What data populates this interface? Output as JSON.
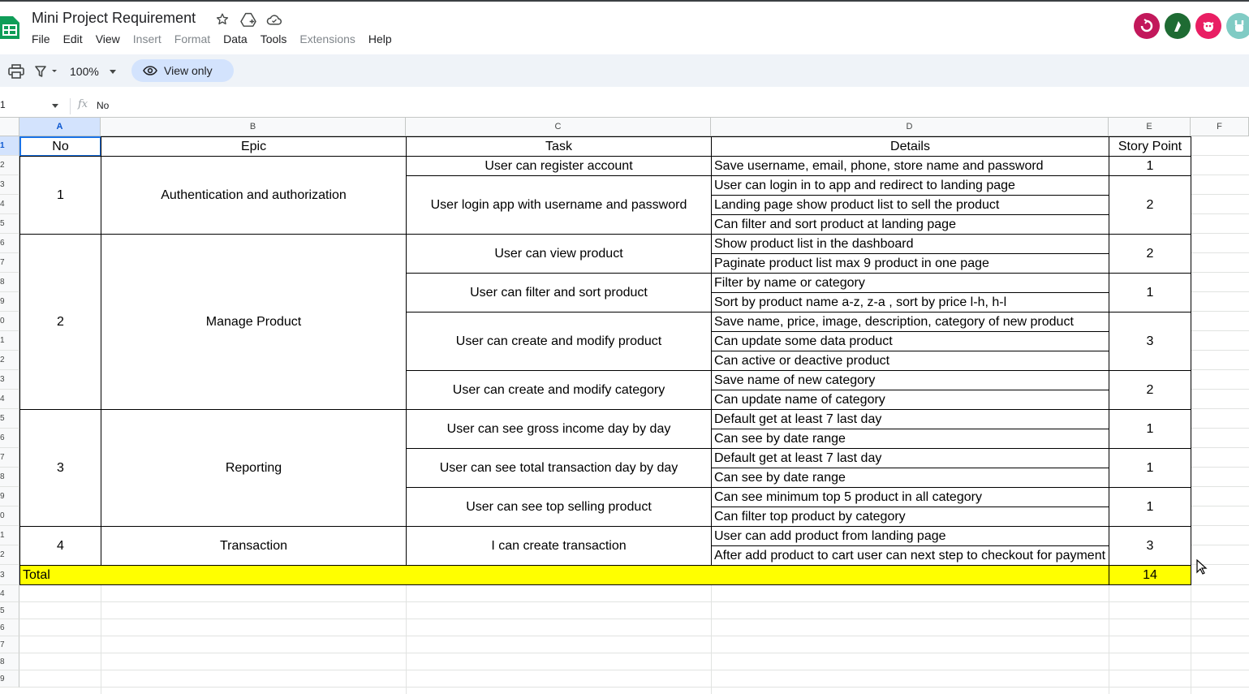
{
  "app": {
    "doc_title": "Mini Project Requirement",
    "menu": [
      "File",
      "Edit",
      "View",
      "Insert",
      "Format",
      "Data",
      "Tools",
      "Extensions",
      "Help"
    ],
    "menu_dimmed": [
      "Insert",
      "Format",
      "Extensions"
    ],
    "brand_color": "#0f9d58"
  },
  "toolbar": {
    "zoom": "100%",
    "view_only_label": "View only"
  },
  "formula_bar": {
    "name_box": "1",
    "fx": "fx",
    "value": "No"
  },
  "sheet": {
    "columns": [
      "A",
      "B",
      "C",
      "D",
      "E",
      "F"
    ],
    "rows": [
      "1",
      "2",
      "3",
      "4",
      "5",
      "6",
      "7",
      "8",
      "9",
      "0",
      "1",
      "2",
      "3",
      "4",
      "5",
      "6",
      "7",
      "8",
      "9",
      "0",
      "1",
      "2",
      "3",
      "4",
      "5",
      "6",
      "7",
      "8",
      "9"
    ],
    "headers": {
      "no": "No",
      "epic": "Epic",
      "task": "Task",
      "details": "Details",
      "story_point": "Story Point"
    },
    "epics": [
      {
        "no": "1",
        "name": "Authentication and authorization"
      },
      {
        "no": "2",
        "name": "Manage Product"
      },
      {
        "no": "3",
        "name": "Reporting"
      },
      {
        "no": "4",
        "name": "Transaction"
      }
    ],
    "tasks": [
      {
        "name": "User can register account",
        "points": "1"
      },
      {
        "name": "User login app with username and password",
        "points": "2"
      },
      {
        "name": "User can view product",
        "points": "2"
      },
      {
        "name": "User can filter and sort product",
        "points": "1"
      },
      {
        "name": "User can create and modify product",
        "points": "3"
      },
      {
        "name": "User can create and modify category",
        "points": "2"
      },
      {
        "name": "User can see gross income day by day",
        "points": "1"
      },
      {
        "name": "User can see total transaction day by day",
        "points": "1"
      },
      {
        "name": "User can see top selling product",
        "points": "1"
      },
      {
        "name": "I can create transaction",
        "points": "3"
      }
    ],
    "details": [
      "Save username, email, phone, store name and password",
      "User can login in to app and redirect to landing page",
      "Landing page show product list to sell the product",
      "Can filter and sort product at landing page",
      "Show product list in the dashboard",
      "Paginate product list max 9 product in one page",
      "Filter by name or category",
      "Sort by product name a-z, z-a , sort by price l-h, h-l",
      "Save name, price, image, description, category of new product",
      "Can update some data product",
      "Can active or deactive product",
      "Save name of new category",
      "Can update name of category",
      "Default get at least 7 last day",
      "Can see by date range",
      "Default get at least 7 last day",
      "Can see by date range",
      "Can see minimum top 5 product in all category",
      "Can filter top product by category",
      "User can add product from landing page",
      "After add product to cart user can next step to checkout for payment"
    ],
    "total_label": "Total",
    "total_value": "14",
    "highlight_color": "#ffff00"
  }
}
